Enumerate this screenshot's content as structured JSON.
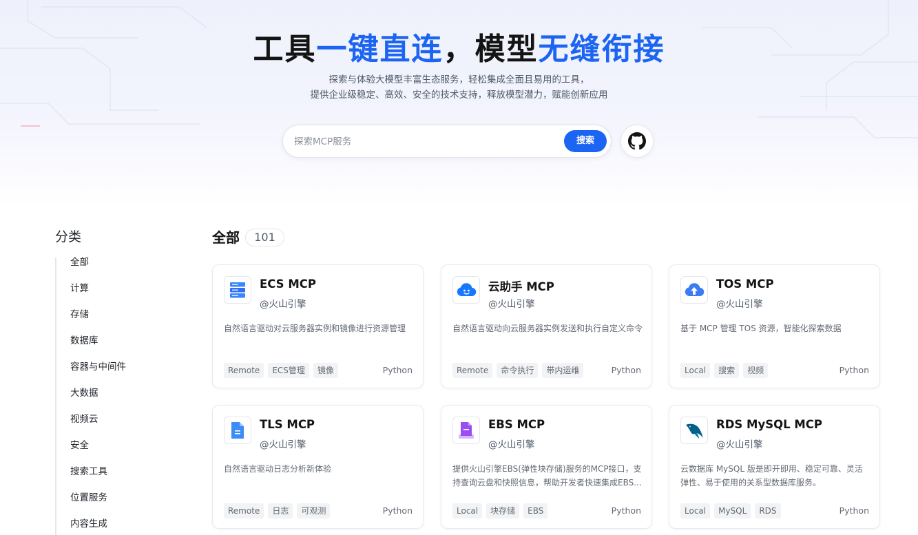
{
  "hero": {
    "title_part1": "工具",
    "title_part2": "一键直连",
    "title_part3": "，模型",
    "title_part4": "无缝衔接",
    "subtitle_line1": "探索与体验大模型丰富生态服务，轻松集成全面且易用的工具，",
    "subtitle_line2": "提供企业级稳定、高效、安全的技术支持，释放模型潜力，赋能创新应用"
  },
  "search": {
    "placeholder": "探索MCP服务",
    "button_label": "搜索"
  },
  "github": {
    "icon": "github-icon"
  },
  "sidebar": {
    "title": "分类",
    "items": [
      "全部",
      "计算",
      "存储",
      "数据库",
      "容器与中间件",
      "大数据",
      "视频云",
      "安全",
      "搜索工具",
      "位置服务",
      "内容生成"
    ]
  },
  "main": {
    "title": "全部",
    "count": "101"
  },
  "cards": [
    {
      "title": "ECS MCP",
      "author": "@火山引擎",
      "description": "自然语言驱动对云服务器实例和镜像进行资源管理",
      "tags": [
        "Remote",
        "ECS管理",
        "镜像"
      ],
      "language": "Python",
      "icon": "server-icon"
    },
    {
      "title": "云助手 MCP",
      "author": "@火山引擎",
      "description": "自然语言驱动向云服务器实例发送和执行自定义命令",
      "tags": [
        "Remote",
        "命令执行",
        "带内运维"
      ],
      "language": "Python",
      "icon": "cloud-assistant-icon"
    },
    {
      "title": "TOS MCP",
      "author": "@火山引擎",
      "description": "基于 MCP 管理 TOS 资源，智能化探索数据",
      "tags": [
        "Local",
        "搜索",
        "视频"
      ],
      "language": "Python",
      "icon": "cloud-upload-icon"
    },
    {
      "title": "TLS MCP",
      "author": "@火山引擎",
      "description": "自然语言驱动日志分析新体验",
      "tags": [
        "Remote",
        "日志",
        "可观测"
      ],
      "language": "Python",
      "icon": "document-icon"
    },
    {
      "title": "EBS MCP",
      "author": "@火山引擎",
      "description": "提供火山引擎EBS(弹性块存储)服务的MCP接口，支持查询云盘和快照信息，帮助开发者快速集成EBS...",
      "tags": [
        "Local",
        "块存储",
        "EBS"
      ],
      "language": "Python",
      "icon": "block-storage-icon"
    },
    {
      "title": "RDS MySQL MCP",
      "author": "@火山引擎",
      "description": "云数据库 MySQL 版是即开即用、稳定可靠、灵活弹性、易于使用的关系型数据库服务。",
      "tags": [
        "Local",
        "MySQL",
        "RDS"
      ],
      "language": "Python",
      "icon": "mysql-dolphin-icon"
    }
  ],
  "colors": {
    "accent": "#1c64f2",
    "hero_bg": "#eef1fb",
    "tag_bg": "#f2f3f5"
  }
}
